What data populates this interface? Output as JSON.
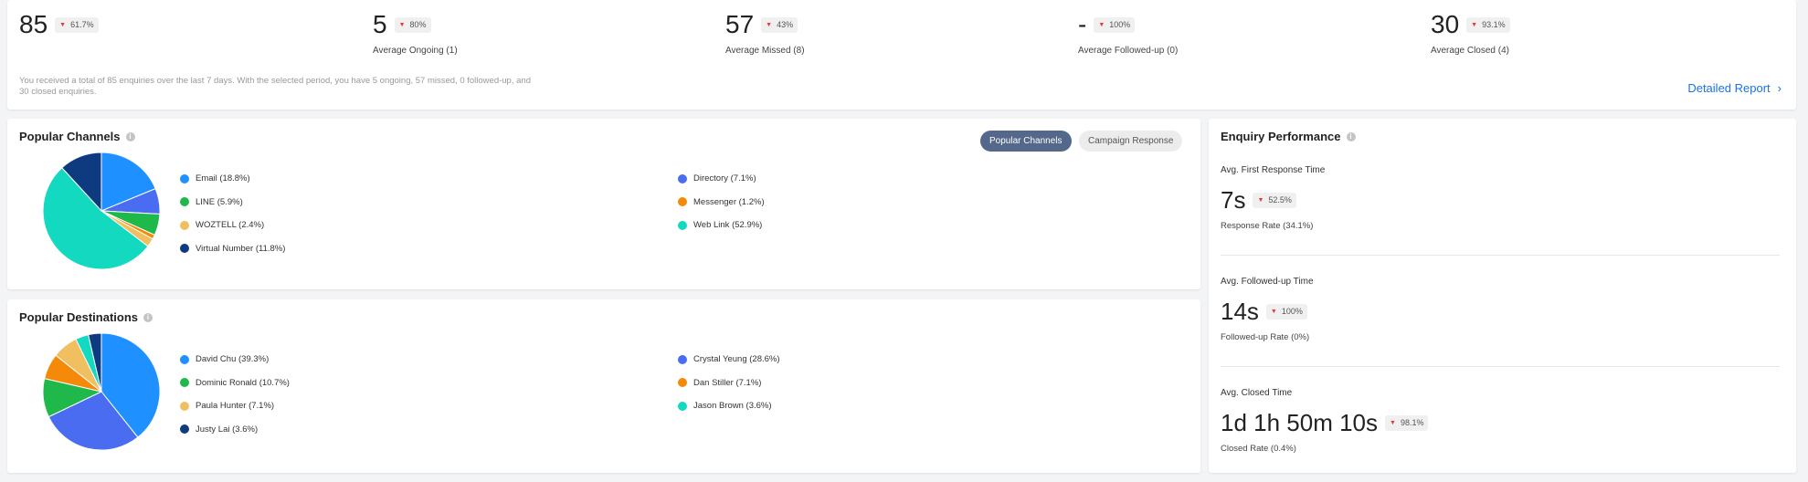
{
  "stats": [
    {
      "value": "85",
      "change": "61.7%",
      "label": ""
    },
    {
      "value": "5",
      "change": "80%",
      "label": "Average Ongoing (1)"
    },
    {
      "value": "57",
      "change": "43%",
      "label": "Average Missed (8)"
    },
    {
      "value": "-",
      "change": "100%",
      "label": "Average Followed-up (0)"
    },
    {
      "value": "30",
      "change": "93.1%",
      "label": "Average Closed (4)"
    }
  ],
  "summary": "You received a total of 85 enquiries over the last 7 days. With the selected period, you have 5 ongoing, 57 missed, 0 followed-up, and 30 closed enquiries.",
  "detailed_report": "Detailed Report",
  "channels": {
    "title": "Popular Channels",
    "tabs": {
      "active": "Popular Channels",
      "inactive": "Campaign Response"
    },
    "items": [
      {
        "label": "Email (18.8%)",
        "pct": 18.8,
        "color": "#1e90ff"
      },
      {
        "label": "Directory (7.1%)",
        "pct": 7.1,
        "color": "#4a6cf0"
      },
      {
        "label": "LINE (5.9%)",
        "pct": 5.9,
        "color": "#1fb84a"
      },
      {
        "label": "Messenger (1.2%)",
        "pct": 1.2,
        "color": "#f58a0a"
      },
      {
        "label": "WOZTELL (2.4%)",
        "pct": 2.4,
        "color": "#f0c060"
      },
      {
        "label": "Web Link (52.9%)",
        "pct": 52.9,
        "color": "#13d9c0"
      },
      {
        "label": "Virtual Number (11.8%)",
        "pct": 11.8,
        "color": "#0e3a80"
      }
    ]
  },
  "destinations": {
    "title": "Popular Destinations",
    "items": [
      {
        "label": "David Chu (39.3%)",
        "pct": 39.3,
        "color": "#1e90ff"
      },
      {
        "label": "Crystal Yeung (28.6%)",
        "pct": 28.6,
        "color": "#4a6cf0"
      },
      {
        "label": "Dominic Ronald (10.7%)",
        "pct": 10.7,
        "color": "#1fb84a"
      },
      {
        "label": "Dan Stiller (7.1%)",
        "pct": 7.1,
        "color": "#f58a0a"
      },
      {
        "label": "Paula Hunter (7.1%)",
        "pct": 7.1,
        "color": "#f0c060"
      },
      {
        "label": "Jason Brown (3.6%)",
        "pct": 3.6,
        "color": "#13d9c0"
      },
      {
        "label": "Justy Lai (3.6%)",
        "pct": 3.6,
        "color": "#0e3a80"
      }
    ]
  },
  "performance": {
    "title": "Enquiry Performance",
    "blocks": [
      {
        "label": "Avg. First Response Time",
        "value": "7s",
        "change": "52.5%",
        "rate": "Response Rate (34.1%)"
      },
      {
        "label": "Avg. Followed-up Time",
        "value": "14s",
        "change": "100%",
        "rate": "Followed-up Rate (0%)"
      },
      {
        "label": "Avg. Closed Time",
        "value": "1d 1h 50m 10s",
        "change": "98.1%",
        "rate": "Closed Rate (0.4%)"
      }
    ]
  },
  "info_icon_glyph": "i",
  "arrow_glyph": "▼",
  "chevron_glyph": "›"
}
